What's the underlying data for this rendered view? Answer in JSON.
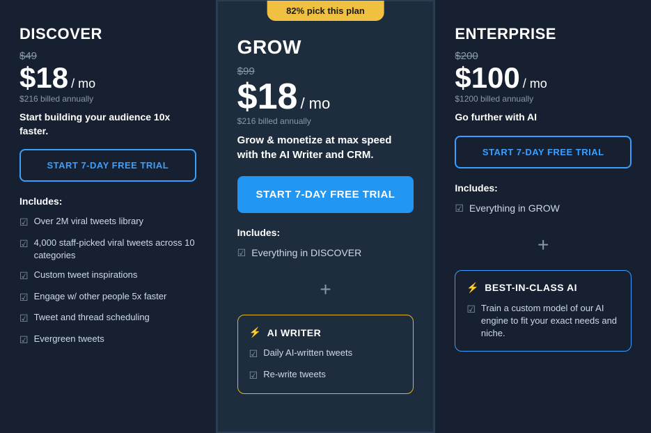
{
  "discover": {
    "name": "DISCOVER",
    "original_price": "$49",
    "price": "$18",
    "per": "/ mo",
    "billed": "$216 billed annually",
    "tagline": "Start building your audience 10x faster.",
    "cta": "START 7-DAY FREE TRIAL",
    "includes_label": "Includes:",
    "features": [
      "Over 2M viral tweets library",
      "4,000 staff-picked viral tweets across 10 categories",
      "Custom tweet inspirations",
      "Engage w/ other people 5x faster",
      "Tweet and thread scheduling",
      "Evergreen tweets"
    ]
  },
  "grow": {
    "badge": "82% pick this plan",
    "name": "GROW",
    "original_price": "$99",
    "price": "$18",
    "per": "/ mo",
    "billed": "$216 billed annually",
    "tagline": "Grow & monetize at max speed with the AI Writer and CRM.",
    "cta": "START 7-DAY FREE TRIAL",
    "includes_label": "Includes:",
    "everything_in": "Everything in DISCOVER",
    "plus": "+",
    "ai_box_title": "AI WRITER",
    "ai_features": [
      "Daily AI-written tweets",
      "Re-write tweets"
    ]
  },
  "enterprise": {
    "name": "ENTERPRISE",
    "original_price": "$200",
    "price": "$100",
    "per": "/ mo",
    "billed": "$1200 billed annually",
    "tagline": "Go further with AI",
    "cta": "START 7-DAY FREE TRIAL",
    "includes_label": "Includes:",
    "everything_in": "Everything in GROW",
    "plus": "+",
    "best_box_title": "BEST-IN-CLASS AI",
    "best_features": [
      "Train a custom model of our AI engine to fit your exact needs and niche."
    ]
  }
}
